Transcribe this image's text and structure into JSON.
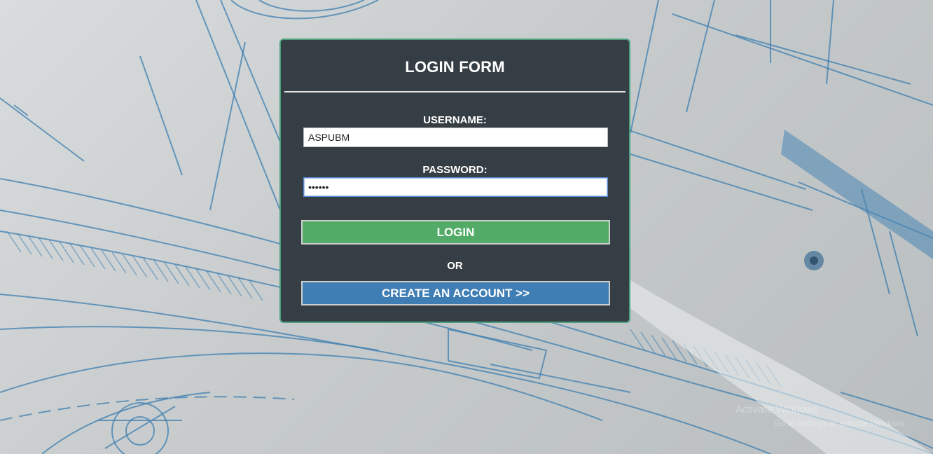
{
  "login_form": {
    "title": "LOGIN FORM",
    "username_label": "USERNAME:",
    "username_value": "ASPUBM",
    "password_label": "PASSWORD:",
    "password_value": "••••••",
    "login_button": "LOGIN",
    "or_text": "OR",
    "create_account_button": "CREATE AN ACCOUNT >>"
  },
  "watermark": {
    "line1": "Activate Windows",
    "line2": "Go to Settings to activate Windows."
  },
  "colors": {
    "panel_bg": "#353e44",
    "panel_border": "#4ea07d",
    "login_button": "#52ac67",
    "create_button": "#3f7db5",
    "background": "#c7cbcc",
    "blueprint_lines": "#3d7fb0"
  },
  "icons": {
    "background": "blueprint-drawing"
  }
}
